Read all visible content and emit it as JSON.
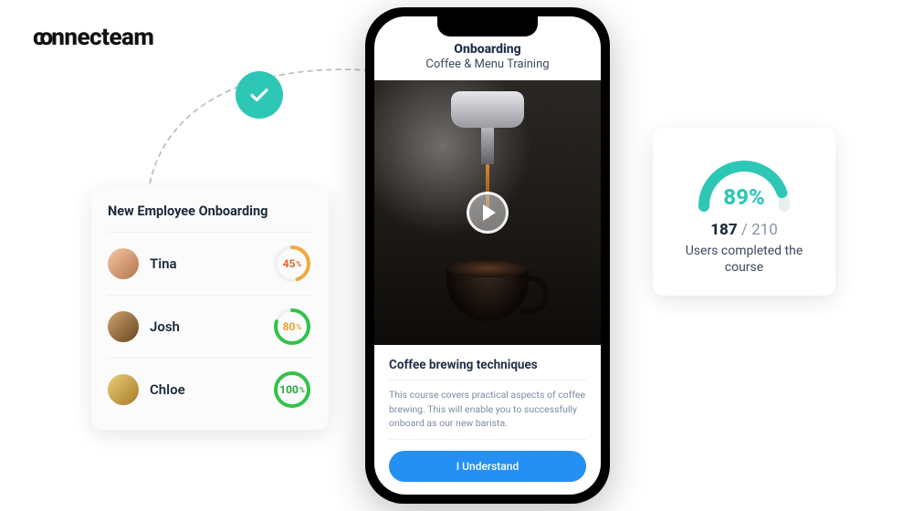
{
  "brand": {
    "name": "connecteam"
  },
  "connector": {
    "checked": true
  },
  "employee_card": {
    "title": "New Employee Onboarding",
    "rows": [
      {
        "name": "Tina",
        "pct": 45,
        "pct_label": "45",
        "ring_color": "#f2a93b",
        "label_color": "#e8642a",
        "avatar_bg": "linear-gradient(135deg,#f4c9a8,#b57248)"
      },
      {
        "name": "Josh",
        "pct": 80,
        "pct_label": "80",
        "ring_color": "#33c24a",
        "label_color": "#e8a12a",
        "avatar_bg": "linear-gradient(135deg,#caa46e,#6a4420)"
      },
      {
        "name": "Chloe",
        "pct": 100,
        "pct_label": "100",
        "ring_color": "#33c24a",
        "label_color": "#27a63c",
        "avatar_bg": "linear-gradient(135deg,#e8cf7a,#a77a28)"
      }
    ]
  },
  "course": {
    "header_title": "Onboarding",
    "header_subtitle": "Coffee & Menu Training",
    "section_title": "Coffee brewing techniques",
    "section_desc": "This course covers practical aspects of coffee brewing. This will enable you to successfully onboard as our new barista.",
    "cta": "I Understand"
  },
  "completion": {
    "pct": 89,
    "pct_label": "89%",
    "done": "187",
    "separator": " / ",
    "total": "210",
    "caption": "Users completed the course",
    "gauge_color": "#2ec7b6",
    "gauge_track": "#e6eef0"
  }
}
